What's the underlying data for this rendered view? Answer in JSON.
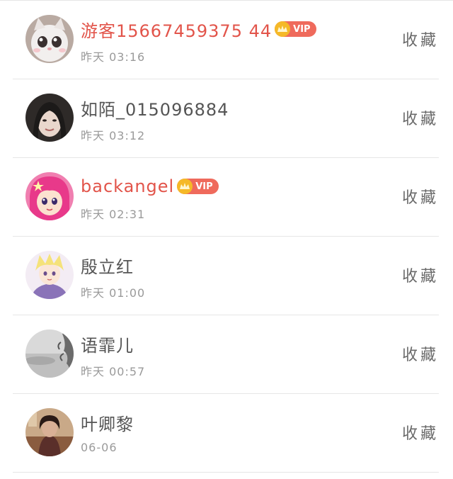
{
  "users": [
    {
      "name": "游客15667459375 44",
      "time": "昨天 03:16",
      "vip": true,
      "action": "收藏",
      "avatar_icon": "cat-avatar"
    },
    {
      "name": "如陌_015096884",
      "time": "昨天 03:12",
      "vip": false,
      "action": "收藏",
      "avatar_icon": "woman-avatar"
    },
    {
      "name": "backangel",
      "time": "昨天 02:31",
      "vip": true,
      "action": "收藏",
      "avatar_icon": "anime-girl-avatar"
    },
    {
      "name": "殷立红",
      "time": "昨天 01:00",
      "vip": false,
      "action": "收藏",
      "avatar_icon": "anime-boy-avatar"
    },
    {
      "name": "语霏儿",
      "time": "昨天 00:57",
      "vip": false,
      "action": "收藏",
      "avatar_icon": "landscape-avatar"
    },
    {
      "name": "叶卿黎",
      "time": "06-06",
      "vip": false,
      "action": "收藏",
      "avatar_icon": "dark-portrait-avatar"
    }
  ],
  "vip_label": "VIP",
  "colors": {
    "vip_name": "#e2544a",
    "normal_name": "#555555",
    "time": "#9a9a9a",
    "badge": "#ef6a5c",
    "crown": "#f5b928"
  }
}
